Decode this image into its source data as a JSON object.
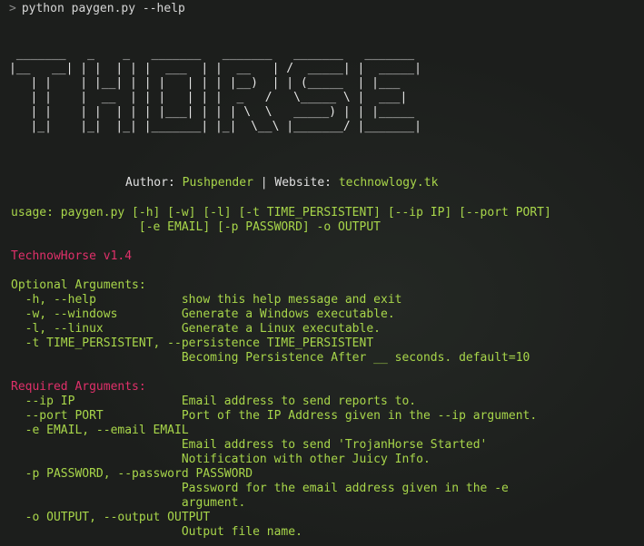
{
  "prompt": {
    "caret": ">",
    "command": "python paygen.py --help"
  },
  "banner": {
    "ascii_art": " _______   _    _   _______   _______   _______   _______ \n|__   __| | |  | | |  ___  | |  __   | /  _____| |  _____|\n   | |    | |__| | | |   | | | |__)  | | (_____  | |___  \n   | |    |  __  | | |   | | |  _   /   \\_____ \\ |  ___| \n   | |    | |  | | | |___| | | | \\  \\   _____) | | |_____\n   |_|    |_|  |_| |_______| |_|  \\__\\ |_______/ |_______|"
  },
  "author_line": {
    "author_label": "Author:",
    "author_name": "Pushpender",
    "separator": "|",
    "website_label": "Website:",
    "website_url": "technowlogy.tk"
  },
  "usage": {
    "line1": "usage: paygen.py [-h] [-w] [-l] [-t TIME_PERSISTENT] [--ip IP] [--port PORT]",
    "line2": "                  [-e EMAIL] [-p PASSWORD] -o OUTPUT"
  },
  "version": "TechnowHorse v1.4",
  "optional": {
    "heading": "Optional Arguments:",
    "lines": [
      "  -h, --help            show this help message and exit",
      "  -w, --windows         Generate a Windows executable.",
      "  -l, --linux           Generate a Linux executable.",
      "  -t TIME_PERSISTENT, --persistence TIME_PERSISTENT",
      "                        Becoming Persistence After __ seconds. default=10"
    ]
  },
  "required": {
    "heading": "Required Arguments:",
    "lines": [
      "  --ip IP               Email address to send reports to.",
      "  --port PORT           Port of the IP Address given in the --ip argument.",
      "  -e EMAIL, --email EMAIL",
      "                        Email address to send 'TrojanHorse Started'",
      "                        Notification with other Juicy Info.",
      "  -p PASSWORD, --password PASSWORD",
      "                        Password for the email address given in the -e",
      "                        argument.",
      "  -o OUTPUT, --output OUTPUT",
      "                        Output file name."
    ]
  },
  "colors": {
    "background": "#1c1e1c",
    "green_text": "#a8d64a",
    "pink_text": "#e0306a",
    "white_text": "#e0e0e0"
  }
}
